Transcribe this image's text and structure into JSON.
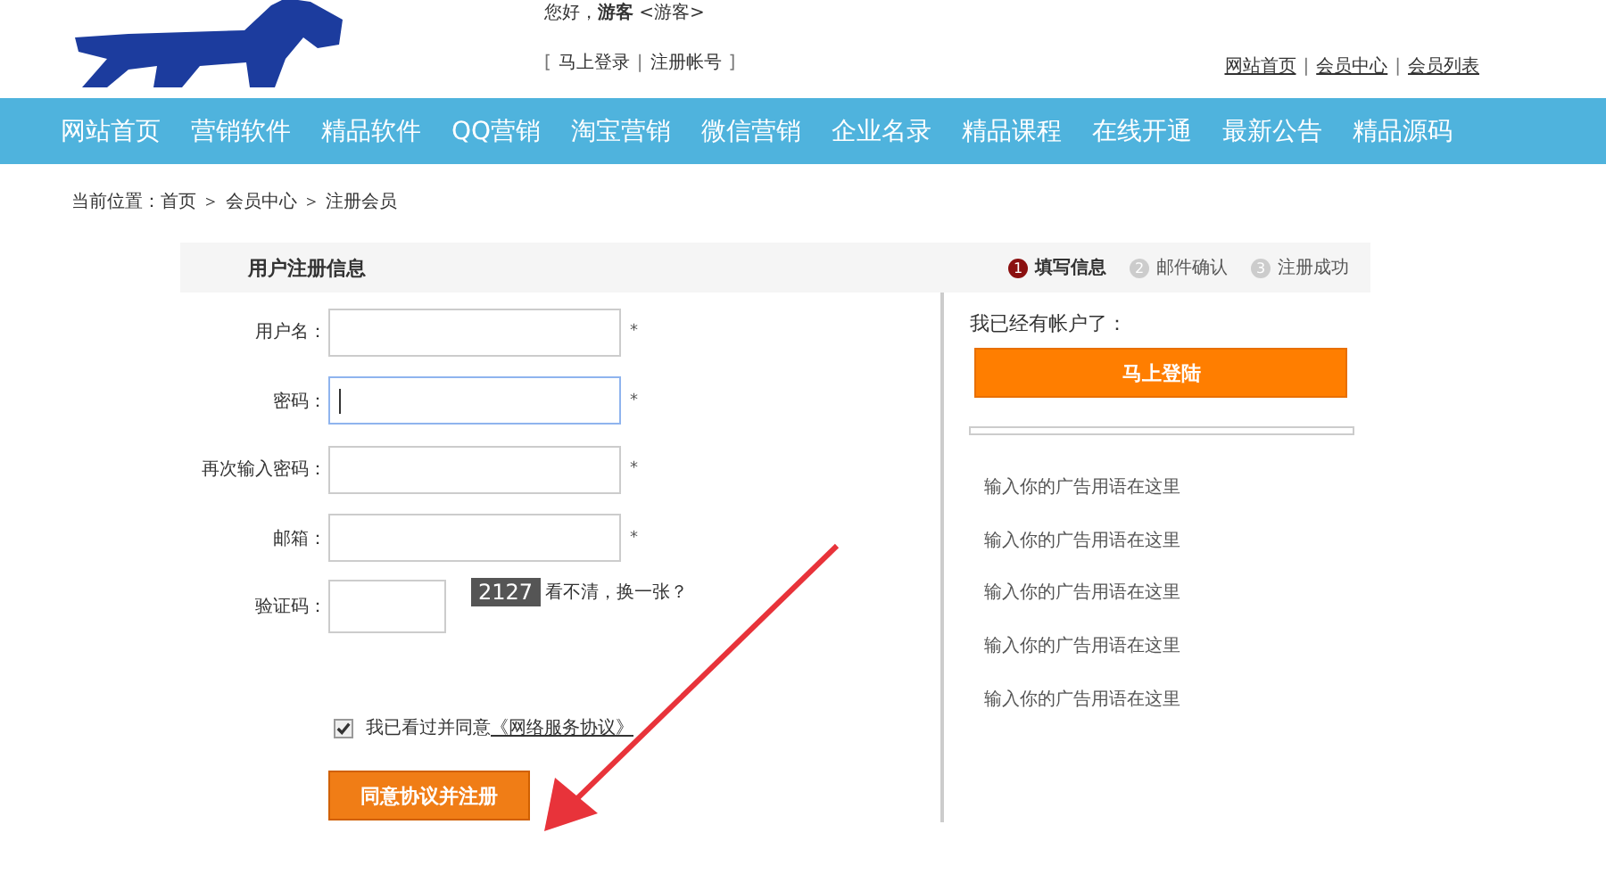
{
  "header": {
    "greeting": "您好，**游客** <游客>",
    "auth_links": [
      {
        "kind": "text",
        "text": "["
      },
      {
        "kind": "link",
        "text": "马上登录"
      },
      {
        "kind": "text",
        "text": "|"
      },
      {
        "kind": "link",
        "text": "注册帐号"
      },
      {
        "kind": "text",
        "text": "]"
      }
    ],
    "top_links": [
      {
        "kind": "link",
        "text": "网站首页"
      },
      {
        "kind": "text",
        "text": "|"
      },
      {
        "kind": "link",
        "text": "会员中心"
      },
      {
        "kind": "text",
        "text": "|"
      },
      {
        "kind": "link",
        "text": "会员列表"
      }
    ]
  },
  "nav": [
    "网站首页",
    "营销软件",
    "精品软件",
    "QQ营销",
    "淘宝营销",
    "微信营销",
    "企业名录",
    "精品课程",
    "在线开通",
    "最新公告",
    "精品源码"
  ],
  "breadcrumb": "当前位置：首页 ＞ 会员中心 ＞ 注册会员",
  "panel": {
    "title": "用户注册信息",
    "steps": [
      {
        "number": "1",
        "label": "填写信息",
        "selected": true
      },
      {
        "number": "2",
        "label": "邮件确认",
        "selected": false
      },
      {
        "number": "3",
        "label": "注册成功",
        "selected": false
      }
    ],
    "fields": [
      {
        "kind": "input",
        "label": "用户名：",
        "focused": false,
        "required": "*"
      },
      {
        "kind": "input",
        "label": "密码：",
        "focused": true,
        "required": "*"
      },
      {
        "kind": "input",
        "label": "再次输入密码：",
        "focused": false,
        "required": "*"
      },
      {
        "kind": "input",
        "label": "邮箱：",
        "focused": false,
        "required": "*"
      },
      {
        "kind": "captcha",
        "label": "验证码：",
        "focused": false,
        "code": "2127",
        "refresh": "看不清，换一张？"
      }
    ],
    "agreement": {
      "checked": true,
      "text": "我已看过并同意",
      "link": "《网络服务协议》"
    },
    "submit": "同意协议并注册",
    "sidebar": {
      "title": "我已经有帐户了：",
      "login": "马上登陆",
      "ads": [
        "输入你的广告用语在这里",
        "输入你的广告用语在这里",
        "输入你的广告用语在这里",
        "输入你的广告用语在这里",
        "输入你的广告用语在这里"
      ]
    }
  }
}
